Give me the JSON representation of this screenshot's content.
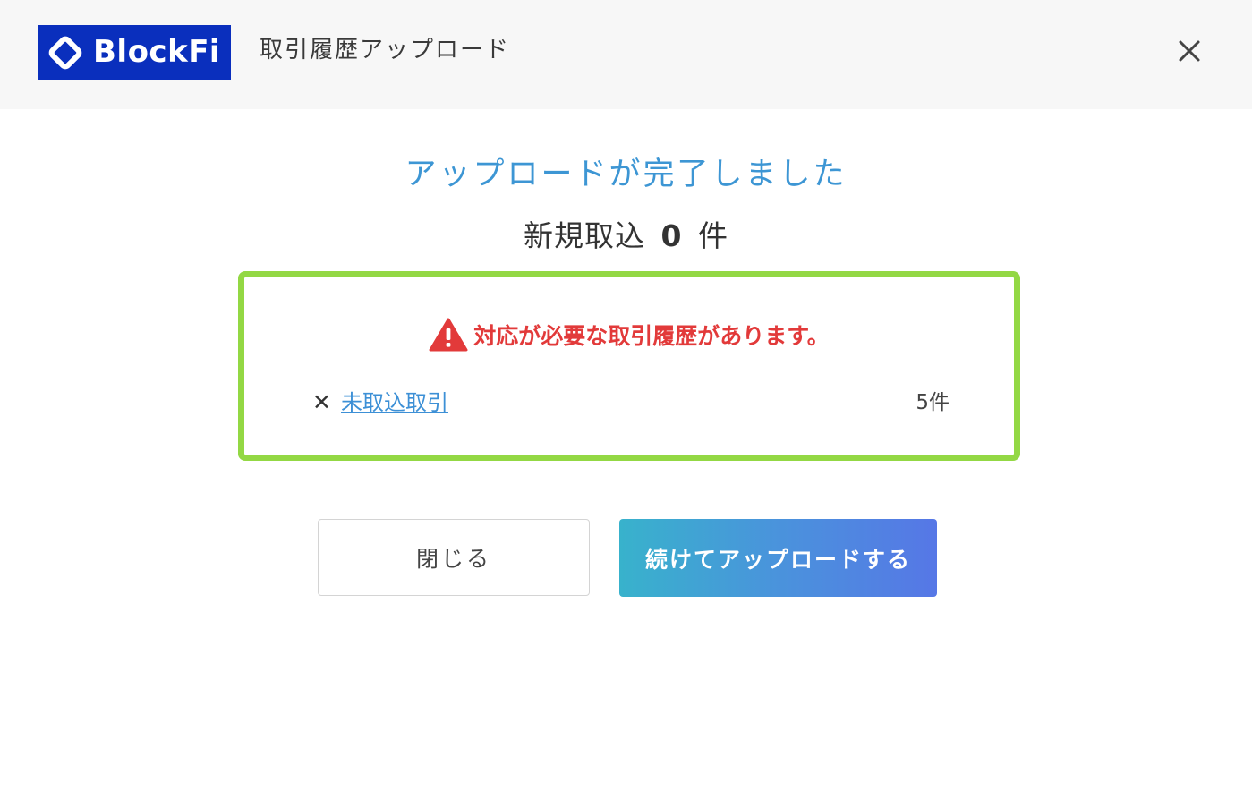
{
  "header": {
    "logo_text": "BlockFi",
    "title": "取引履歴アップロード",
    "close_icon": "close-icon"
  },
  "main": {
    "headline": "アップロードが完了しました",
    "count_prefix": "新規取込",
    "count_value": "0",
    "count_suffix": "件"
  },
  "alert": {
    "icon": "warning-icon",
    "message": "対応が必要な取引履歴があります。",
    "items": [
      {
        "marker": "✕",
        "label": "未取込取引",
        "count": "5件"
      }
    ]
  },
  "buttons": {
    "close_label": "閉じる",
    "continue_label": "続けてアップロードする"
  },
  "colors": {
    "brand": "#0a2fbd",
    "headline": "#3d96d4",
    "alert_text": "#e23a3a",
    "alert_border": "#93d844",
    "link": "#3d90d6",
    "button_gradient_start": "#38b2cc",
    "button_gradient_end": "#5677e6"
  }
}
